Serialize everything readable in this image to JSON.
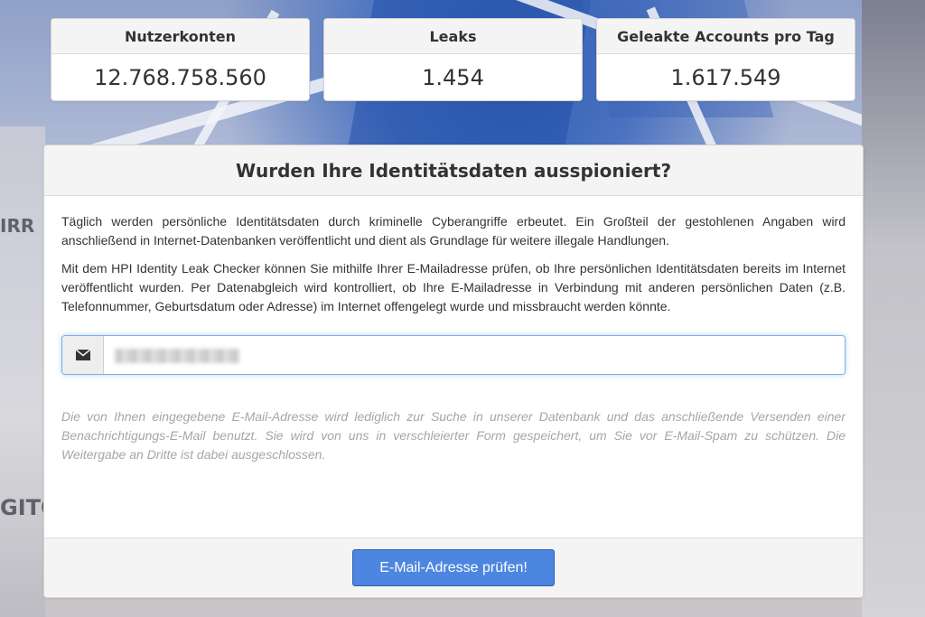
{
  "stats": [
    {
      "label": "Nutzerkonten",
      "value": "12.768.758.560"
    },
    {
      "label": "Leaks",
      "value": "1.454"
    },
    {
      "label": "Geleakte Accounts pro Tag",
      "value": "1.617.549"
    }
  ],
  "background": {
    "sign_left_top": "IRR",
    "sign_left_bottom": "GITO"
  },
  "panel": {
    "title": "Wurden Ihre Identitätsdaten ausspioniert?",
    "paragraph1": "Täglich werden persönliche Identitätsdaten durch kriminelle Cyberangriffe erbeutet. Ein Großteil der gestohlenen Angaben wird anschließend in Internet-Datenbanken veröffentlicht und dient als Grundlage für weitere illegale Handlungen.",
    "paragraph2": "Mit dem HPI Identity Leak Checker können Sie mithilfe Ihrer E-Mailadresse prüfen, ob Ihre persönlichen Identitätsdaten bereits im Internet veröffentlicht wurden. Per Datenabgleich wird kontrolliert, ob Ihre E-Mailadresse in Verbindung mit anderen persönlichen Daten (z.B. Telefonnummer, Geburtsdatum oder Adresse) im Internet offengelegt wurde und missbraucht werden könnte.",
    "email_icon": "envelope-icon",
    "email_value": "",
    "privacy_note": "Die von Ihnen eingegebene E-Mail-Adresse wird lediglich zur Suche in unserer Datenbank und das anschließende Versenden einer Benachrichtigungs-E-Mail benutzt. Sie wird von uns in verschleierter Form gespeichert, um Sie vor E-Mail-Spam zu schützen. Die Weitergabe an Dritte ist dabei ausgeschlossen.",
    "submit_label": "E-Mail-Adresse prüfen!"
  },
  "colors": {
    "button": "#4d86e0",
    "focus_border": "#7aaee8",
    "note_text": "#a6a6a6"
  }
}
